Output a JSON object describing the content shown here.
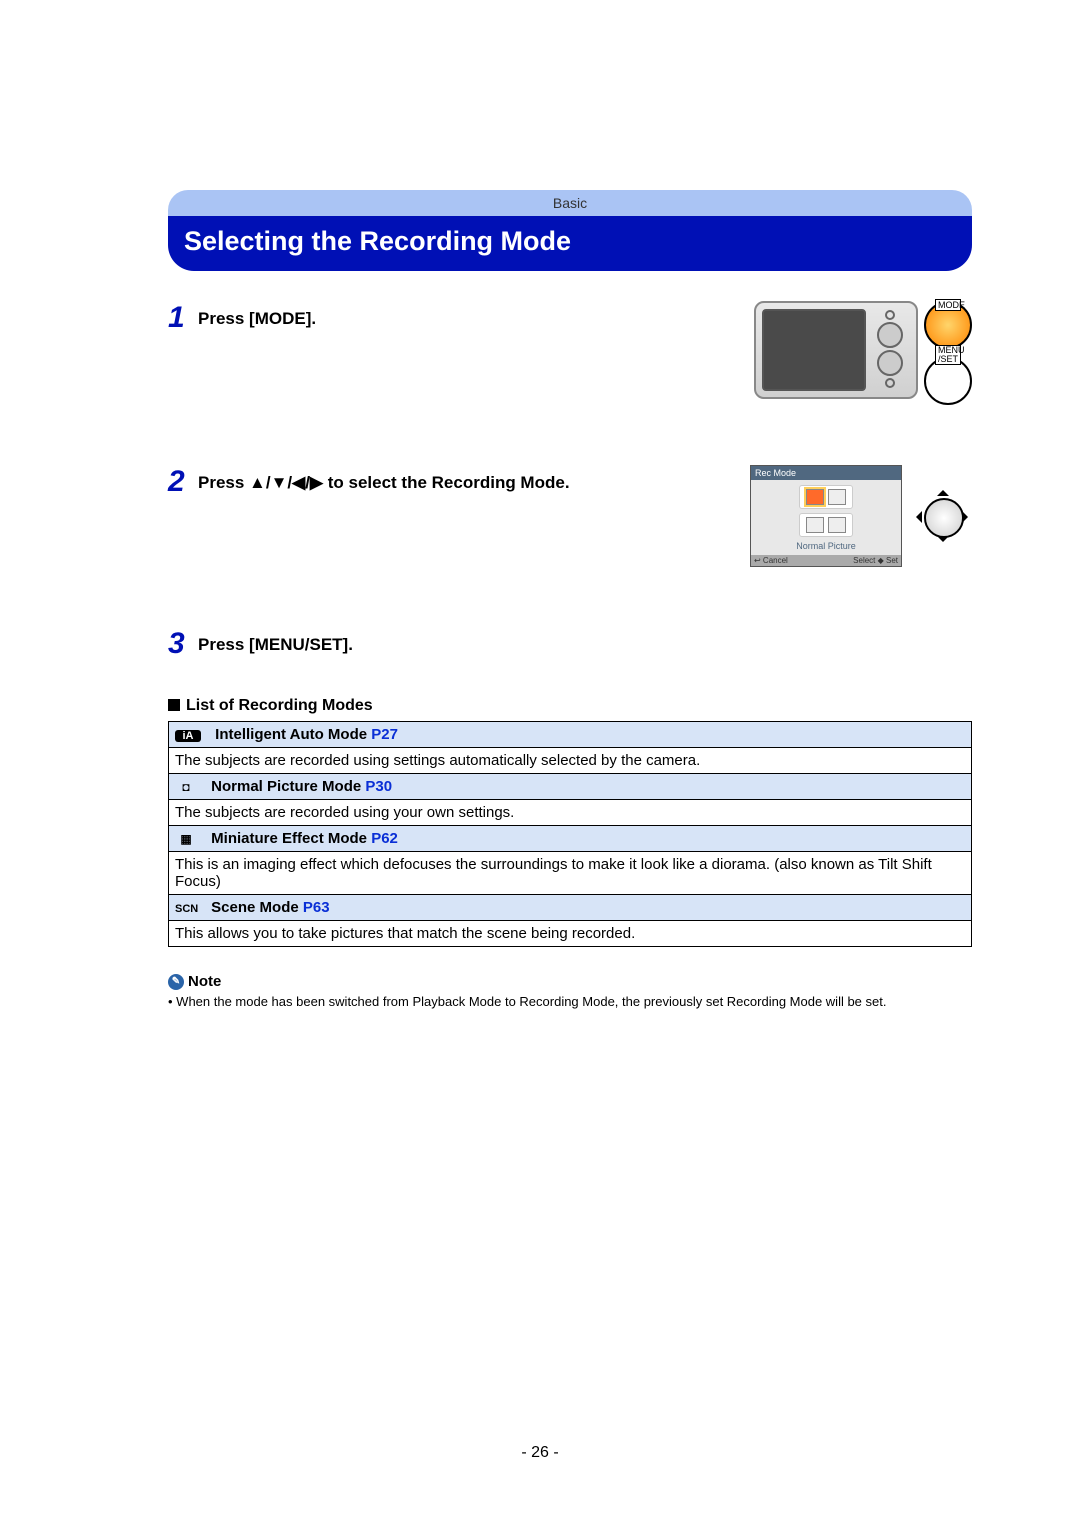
{
  "header": {
    "chapter": "Basic",
    "title": "Selecting the Recording Mode"
  },
  "steps": [
    {
      "num": "1",
      "text": "Press [MODE]."
    },
    {
      "num": "2",
      "text": "Press ▲/▼/◀/▶ to select the Recording Mode."
    },
    {
      "num": "3",
      "text": "Press [MENU/SET]."
    }
  ],
  "camera_buttons": {
    "mode": "MODE",
    "menu": "MENU\n/SET"
  },
  "rec_screen": {
    "title": "Rec Mode",
    "caption": "Normal Picture",
    "cancel": "↩ Cancel",
    "select": "Select ◆ Set"
  },
  "list": {
    "heading": "List of Recording Modes",
    "rows": [
      {
        "icon": "iA",
        "name": "Intelligent Auto Mode",
        "ref": "P27",
        "desc": "The subjects are recorded using settings automatically selected by the camera."
      },
      {
        "icon": "◘",
        "name": "Normal Picture Mode",
        "ref": "P30",
        "desc": "The subjects are recorded using your own settings."
      },
      {
        "icon": "▦",
        "name": "Miniature Effect Mode",
        "ref": "P62",
        "desc": "This is an imaging effect which defocuses the surroundings to make it look like a diorama. (also known as Tilt Shift Focus)"
      },
      {
        "icon": "SCN",
        "name": "Scene Mode",
        "ref": "P63",
        "desc": "This allows you to take pictures that match the scene being recorded."
      }
    ]
  },
  "note": {
    "label": "Note",
    "text": "When the mode has been switched from Playback Mode to Recording Mode, the previously set Recording Mode will be set."
  },
  "page": "- 26 -"
}
